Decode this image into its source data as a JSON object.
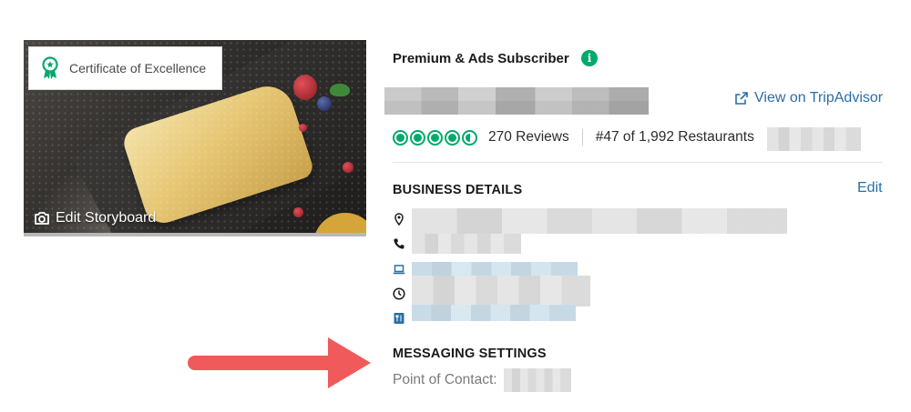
{
  "photo": {
    "certificate_label": "Certificate of Excellence",
    "edit_storyboard_label": "Edit Storyboard"
  },
  "header": {
    "subscriber_label": "Premium & Ads Subscriber",
    "info_icon": "i",
    "view_link_label": "View on TripAdvisor"
  },
  "rating": {
    "bubbles": 4.5,
    "reviews_label": "270 Reviews",
    "rank_label": "#47 of 1,992 Restaurants"
  },
  "business_details": {
    "title": "BUSINESS DETAILS",
    "edit_label": "Edit",
    "items": [
      {
        "icon": "location-pin-icon"
      },
      {
        "icon": "phone-icon"
      },
      {
        "icon": "laptop-icon"
      },
      {
        "icon": "clock-icon"
      },
      {
        "icon": "menu-icon"
      }
    ]
  },
  "messaging": {
    "title": "MESSAGING SETTINGS",
    "point_of_contact_label": "Point of Contact:"
  },
  "colors": {
    "brand_green": "#00aa6c",
    "link_blue": "#2a6ea5",
    "arrow_red": "#f05a5a"
  }
}
